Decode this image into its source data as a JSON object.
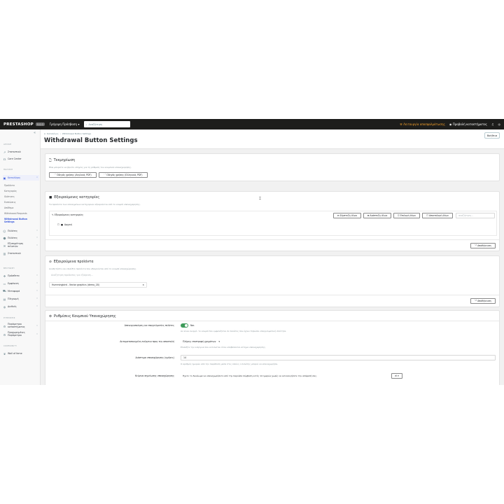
{
  "header": {
    "logo": "PRESTASHOP",
    "version": "9.0.0",
    "quick_access": "Γρήγορη Πρόσβαση",
    "search_placeholder": "Αναζήτηση",
    "debug_mode": "Λειτουργία αποσφαλμάτωσης",
    "view_shop": "Προβολή καταστήματος"
  },
  "sidebar": {
    "sec_dashboard": "ΑΡΧΙΚΗ",
    "stats": "Στατιστικά",
    "care_center": "Care Center",
    "sec_sell": "ΠΩΛΗΣΗ",
    "products": "Καταλόγος",
    "sub_items": [
      "Προϊόντα",
      "Κατηγορίες",
      "Ιδιότητες",
      "Εκπτώσεις",
      "Απόθεμα",
      "Withdrawal Requests",
      "Withdrawal Button Settings"
    ],
    "customers": "Πελάτες",
    "customer_service": "Εξυπηρέτηση πελατών",
    "stats2": "Στατιστικά",
    "sec_improve": "ΒΕΛΤΙΩΣΗ",
    "modules": "Πρόσθετα",
    "design": "Εμφάνιση",
    "shipping": "Μεταφορά",
    "payment": "Πληρωμή",
    "international": "Διεθνές",
    "sec_configure": "ΡΥΘΜΙΣΕΙΣ",
    "shop_params": "Παράμετροι καταστήματος",
    "adv_params": "Προχωρημένες Παράμετροι",
    "sec_community": "COMMUNITY",
    "wall": "Wall of fame"
  },
  "page": {
    "breadcrumb_1": "Καταλόγος",
    "breadcrumb_2": "Withdrawal Button Settings",
    "title": "Withdrawal Button Settings",
    "help": "Βοήθεια"
  },
  "docs": {
    "title": "Τεκμηρίωση",
    "desc": "Εδώ μπορείτε να βρείτε οδηγίες για τη ρύθμιση του κουμπιού υπαναχώρησης.",
    "btn_en": "Οδηγός χρήσης (Αγγλικά, PDF)",
    "btn_el": "Οδηγός χρήσης (Ελληνικά, PDF)"
  },
  "categories": {
    "title": "Εξαιρούμενες κατηγορίες",
    "desc": "Τα προϊόντα των επιλεγμένων κατηγοριών εξαιρούνται από το κουμπί υπαναχώρησης.",
    "tree_label": "Εξαιρούμενες κατηγορίες",
    "collapse_all": "Σύμπτυξη όλων",
    "expand_all": "Ανάπτυξη όλων",
    "select_all": "Επιλογή όλων",
    "unselect_all": "Αποεπιλογή όλων",
    "search_placeholder": "αναζήτηση...",
    "root": "Αρχική",
    "save": "Αποθήκευση"
  },
  "products": {
    "title": "Εξαιρούμενα προϊόντα",
    "desc": "Αναζητήστε και επιλέξτε προϊόντα που εξαιρούνται από το κουμπί υπαναχώρησης.",
    "search_placeholder": "Αναζήτηση προϊόντος για εξαίρεση...",
    "selected": "Hummingbird - Vector graphics (demo_18)",
    "save": "Αποθήκευση"
  },
  "settings": {
    "title": "Ρυθμίσεις Κουμπιού Υπαναχώρησης",
    "row1_label": "Απενεργοποίηση για επαγγελματίες πελάτες",
    "row1_value": "Ναι",
    "row1_help": "Αν είναι ενεργό, το κουμπί δεν εμφανίζεται σε πελάτες που έχουν δηλώσει επαγγελματική ιδιότητα.",
    "row2_label": "Αυτοματοποιημένη ενέργεια προς την αποστολή",
    "row2_value": "Πλήρης επιστροφή χρημάτων",
    "row2_help": "Επιλέξτε την ενέργεια που εκτελείται όταν υποβάλλεται αίτημα υπαναχώρησης.",
    "row3_label": "Διάστημα υπαναχώρησης (ημέρες)",
    "row3_value": "14",
    "row3_help": "Ο αριθμός ημερών από την παράδοση μέσα στις οποίες ο πελάτης μπορεί να υπαναχωρήσει.",
    "row4_label": "Κείμενο σημείωσης υπαναχώρησης",
    "row4_value": "Έχετε το δικαίωμα να υπαναχωρήσετε από την παρούσα σύμβαση εντός 14 ημερών χωρίς να αιτιολογήσετε την απόφασή σας.",
    "row4_lang": "el"
  }
}
